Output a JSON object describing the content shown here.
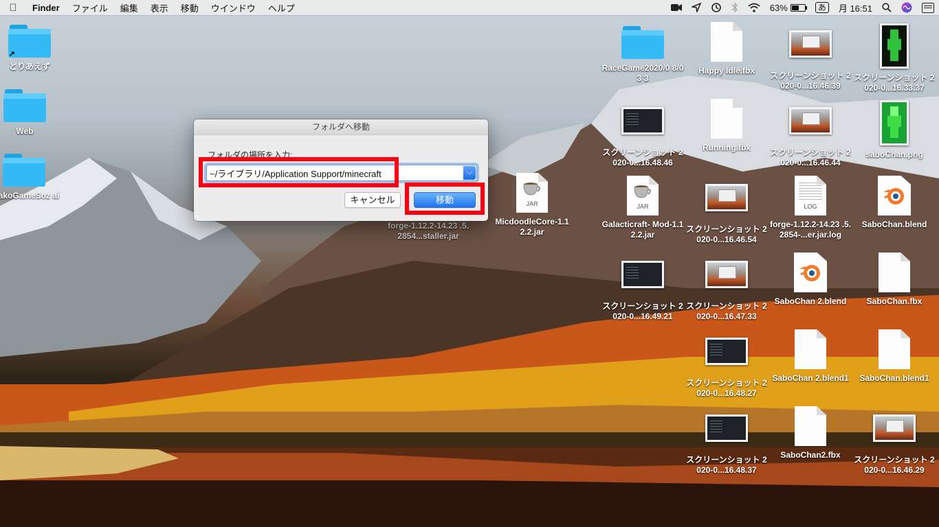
{
  "menubar": {
    "app_name": "Finder",
    "menus": [
      "ファイル",
      "編集",
      "表示",
      "移動",
      "ウインドウ",
      "ヘルプ"
    ],
    "battery_percent": "63%",
    "input_method": "あ",
    "clock": "月 16:51",
    "battery_level": 0.63,
    "status_icons": [
      "screen-record-icon",
      "location-arrow-icon",
      "time-machine-icon",
      "bluetooth-icon",
      "wifi-icon",
      "battery-icon",
      "ime-icon",
      "search-icon",
      "siri-icon",
      "control-center-icon"
    ]
  },
  "dialog": {
    "title": "フォルダへ移動",
    "prompt": "フォルダの場所を入力:",
    "path_value": "~/ライブラリ/Application Support/minecraft",
    "cancel_label": "キャンセル",
    "go_label": "移動"
  },
  "desktop_left": [
    {
      "label": "とりあえず",
      "icon": "folder-alias-icon"
    },
    {
      "label": "Web",
      "icon": "folder-icon"
    },
    {
      "label": "abakoGameSoz ai",
      "icon": "folder-icon"
    }
  ],
  "desktop_right": [
    {
      "label": "RaceGame2020/0 8/03 3",
      "icon": "folder-icon"
    },
    {
      "label": "Happy Idle.fbx",
      "icon": "document-icon"
    },
    {
      "label": "スクリーンショット 2020-0...16.46.39",
      "icon": "screenshot-thumbnail"
    },
    {
      "label": "スクリーンショット 2020-0...16.33.37",
      "icon": "screenshot-thumbnail"
    },
    {
      "label": "スクリーンショット 2020-0...16.48.46",
      "icon": "screenshot-thumbnail"
    },
    {
      "label": "Running.fbx",
      "icon": "document-icon"
    },
    {
      "label": "スクリーンショット 2020-0...16.46.44",
      "icon": "screenshot-thumbnail"
    },
    {
      "label": "saboChan.png",
      "icon": "image-thumbnail"
    },
    {
      "label": "forge-1.12.2-14.23 .5.2854...staller.jar",
      "icon": "jar-icon"
    },
    {
      "label": "MicdoodleCore-1.1 2.2.jar",
      "icon": "jar-icon"
    },
    {
      "label": "Galacticraft- Mod-1.12.2.jar",
      "icon": "jar-icon"
    },
    {
      "label": "スクリーンショット 2020-0...16.46.54",
      "icon": "screenshot-thumbnail"
    },
    {
      "label": "forge-1.12.2-14.23 .5.2854-...er.jar.log",
      "icon": "log-icon"
    },
    {
      "label": "SaboChan.blend",
      "icon": "blender-icon"
    },
    {
      "label": "スクリーンショット 2020-0...16.49.21",
      "icon": "screenshot-thumbnail"
    },
    {
      "label": "スクリーンショット 2020-0...16.47.33",
      "icon": "screenshot-thumbnail"
    },
    {
      "label": "SaboChan 2.blend",
      "icon": "blender-icon"
    },
    {
      "label": "SaboChan.fbx",
      "icon": "document-icon"
    },
    {
      "label": "スクリーンショット 2020-0...16.48.27",
      "icon": "screenshot-thumbnail"
    },
    {
      "label": "SaboChan 2.blend1",
      "icon": "document-icon"
    },
    {
      "label": "SaboChan.blend1",
      "icon": "document-icon"
    },
    {
      "label": "スクリーンショット 2020-0...16.48.37",
      "icon": "screenshot-thumbnail"
    },
    {
      "label": "SaboChan2.fbx",
      "icon": "document-icon"
    },
    {
      "label": "スクリーンショット 2020-0...16.46.29",
      "icon": "screenshot-thumbnail"
    }
  ],
  "jar_tag": "JAR",
  "log_tag": "LOG",
  "colors": {
    "annotation_red": "#ff0010",
    "accent_blue": "#1d75ef",
    "folder_blue": "#35baf6"
  }
}
